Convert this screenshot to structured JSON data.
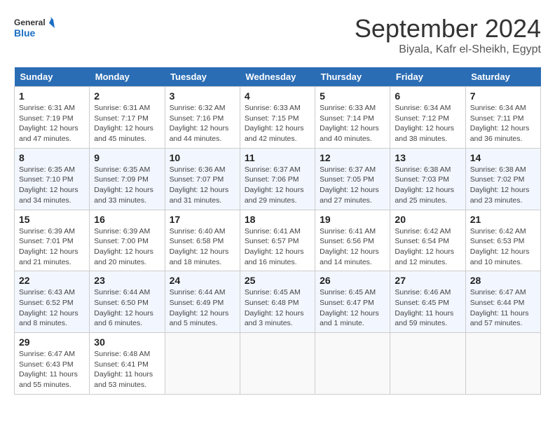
{
  "header": {
    "logo_line1": "General",
    "logo_line2": "Blue",
    "month": "September 2024",
    "location": "Biyala, Kafr el-Sheikh, Egypt"
  },
  "weekdays": [
    "Sunday",
    "Monday",
    "Tuesday",
    "Wednesday",
    "Thursday",
    "Friday",
    "Saturday"
  ],
  "weeks": [
    [
      {
        "day": "1",
        "info": "Sunrise: 6:31 AM\nSunset: 7:19 PM\nDaylight: 12 hours and 47 minutes."
      },
      {
        "day": "2",
        "info": "Sunrise: 6:31 AM\nSunset: 7:17 PM\nDaylight: 12 hours and 45 minutes."
      },
      {
        "day": "3",
        "info": "Sunrise: 6:32 AM\nSunset: 7:16 PM\nDaylight: 12 hours and 44 minutes."
      },
      {
        "day": "4",
        "info": "Sunrise: 6:33 AM\nSunset: 7:15 PM\nDaylight: 12 hours and 42 minutes."
      },
      {
        "day": "5",
        "info": "Sunrise: 6:33 AM\nSunset: 7:14 PM\nDaylight: 12 hours and 40 minutes."
      },
      {
        "day": "6",
        "info": "Sunrise: 6:34 AM\nSunset: 7:12 PM\nDaylight: 12 hours and 38 minutes."
      },
      {
        "day": "7",
        "info": "Sunrise: 6:34 AM\nSunset: 7:11 PM\nDaylight: 12 hours and 36 minutes."
      }
    ],
    [
      {
        "day": "8",
        "info": "Sunrise: 6:35 AM\nSunset: 7:10 PM\nDaylight: 12 hours and 34 minutes."
      },
      {
        "day": "9",
        "info": "Sunrise: 6:35 AM\nSunset: 7:09 PM\nDaylight: 12 hours and 33 minutes."
      },
      {
        "day": "10",
        "info": "Sunrise: 6:36 AM\nSunset: 7:07 PM\nDaylight: 12 hours and 31 minutes."
      },
      {
        "day": "11",
        "info": "Sunrise: 6:37 AM\nSunset: 7:06 PM\nDaylight: 12 hours and 29 minutes."
      },
      {
        "day": "12",
        "info": "Sunrise: 6:37 AM\nSunset: 7:05 PM\nDaylight: 12 hours and 27 minutes."
      },
      {
        "day": "13",
        "info": "Sunrise: 6:38 AM\nSunset: 7:03 PM\nDaylight: 12 hours and 25 minutes."
      },
      {
        "day": "14",
        "info": "Sunrise: 6:38 AM\nSunset: 7:02 PM\nDaylight: 12 hours and 23 minutes."
      }
    ],
    [
      {
        "day": "15",
        "info": "Sunrise: 6:39 AM\nSunset: 7:01 PM\nDaylight: 12 hours and 21 minutes."
      },
      {
        "day": "16",
        "info": "Sunrise: 6:39 AM\nSunset: 7:00 PM\nDaylight: 12 hours and 20 minutes."
      },
      {
        "day": "17",
        "info": "Sunrise: 6:40 AM\nSunset: 6:58 PM\nDaylight: 12 hours and 18 minutes."
      },
      {
        "day": "18",
        "info": "Sunrise: 6:41 AM\nSunset: 6:57 PM\nDaylight: 12 hours and 16 minutes."
      },
      {
        "day": "19",
        "info": "Sunrise: 6:41 AM\nSunset: 6:56 PM\nDaylight: 12 hours and 14 minutes."
      },
      {
        "day": "20",
        "info": "Sunrise: 6:42 AM\nSunset: 6:54 PM\nDaylight: 12 hours and 12 minutes."
      },
      {
        "day": "21",
        "info": "Sunrise: 6:42 AM\nSunset: 6:53 PM\nDaylight: 12 hours and 10 minutes."
      }
    ],
    [
      {
        "day": "22",
        "info": "Sunrise: 6:43 AM\nSunset: 6:52 PM\nDaylight: 12 hours and 8 minutes."
      },
      {
        "day": "23",
        "info": "Sunrise: 6:44 AM\nSunset: 6:50 PM\nDaylight: 12 hours and 6 minutes."
      },
      {
        "day": "24",
        "info": "Sunrise: 6:44 AM\nSunset: 6:49 PM\nDaylight: 12 hours and 5 minutes."
      },
      {
        "day": "25",
        "info": "Sunrise: 6:45 AM\nSunset: 6:48 PM\nDaylight: 12 hours and 3 minutes."
      },
      {
        "day": "26",
        "info": "Sunrise: 6:45 AM\nSunset: 6:47 PM\nDaylight: 12 hours and 1 minute."
      },
      {
        "day": "27",
        "info": "Sunrise: 6:46 AM\nSunset: 6:45 PM\nDaylight: 11 hours and 59 minutes."
      },
      {
        "day": "28",
        "info": "Sunrise: 6:47 AM\nSunset: 6:44 PM\nDaylight: 11 hours and 57 minutes."
      }
    ],
    [
      {
        "day": "29",
        "info": "Sunrise: 6:47 AM\nSunset: 6:43 PM\nDaylight: 11 hours and 55 minutes."
      },
      {
        "day": "30",
        "info": "Sunrise: 6:48 AM\nSunset: 6:41 PM\nDaylight: 11 hours and 53 minutes."
      },
      null,
      null,
      null,
      null,
      null
    ]
  ]
}
